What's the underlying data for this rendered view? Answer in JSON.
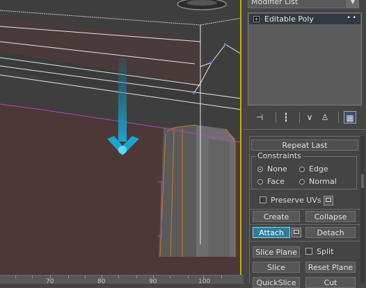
{
  "ruler": {
    "labels": [
      "70",
      "80",
      "90",
      "100"
    ]
  },
  "panel": {
    "modifier_list": "Modifier List",
    "stack_item": "Editable Poly",
    "tools": [
      {
        "name": "pin-stack-icon",
        "glyph": "⊣"
      },
      {
        "name": "show-end-result-icon",
        "glyph": "┇"
      },
      {
        "name": "make-unique-icon",
        "glyph": "∨"
      },
      {
        "name": "remove-modifier-icon",
        "glyph": "⚗"
      },
      {
        "name": "configure-sets-icon",
        "glyph": "▦"
      }
    ]
  },
  "rollout": {
    "repeat_last": "Repeat Last",
    "constraints": {
      "title": "Constraints",
      "options": [
        "None",
        "Edge",
        "Face",
        "Normal"
      ],
      "selected": "None"
    },
    "preserve_uvs": "Preserve UVs",
    "create": "Create",
    "collapse": "Collapse",
    "attach": "Attach",
    "detach": "Detach",
    "slice_plane": "Slice Plane",
    "split": "Split",
    "slice": "Slice",
    "reset_plane": "Reset Plane",
    "quickslice": "QuickSlice",
    "cut": "Cut"
  },
  "colors": {
    "active_button": "#2f7f99",
    "viewport_border": "#c8aa1e",
    "arrow": "#1a8fb0"
  }
}
